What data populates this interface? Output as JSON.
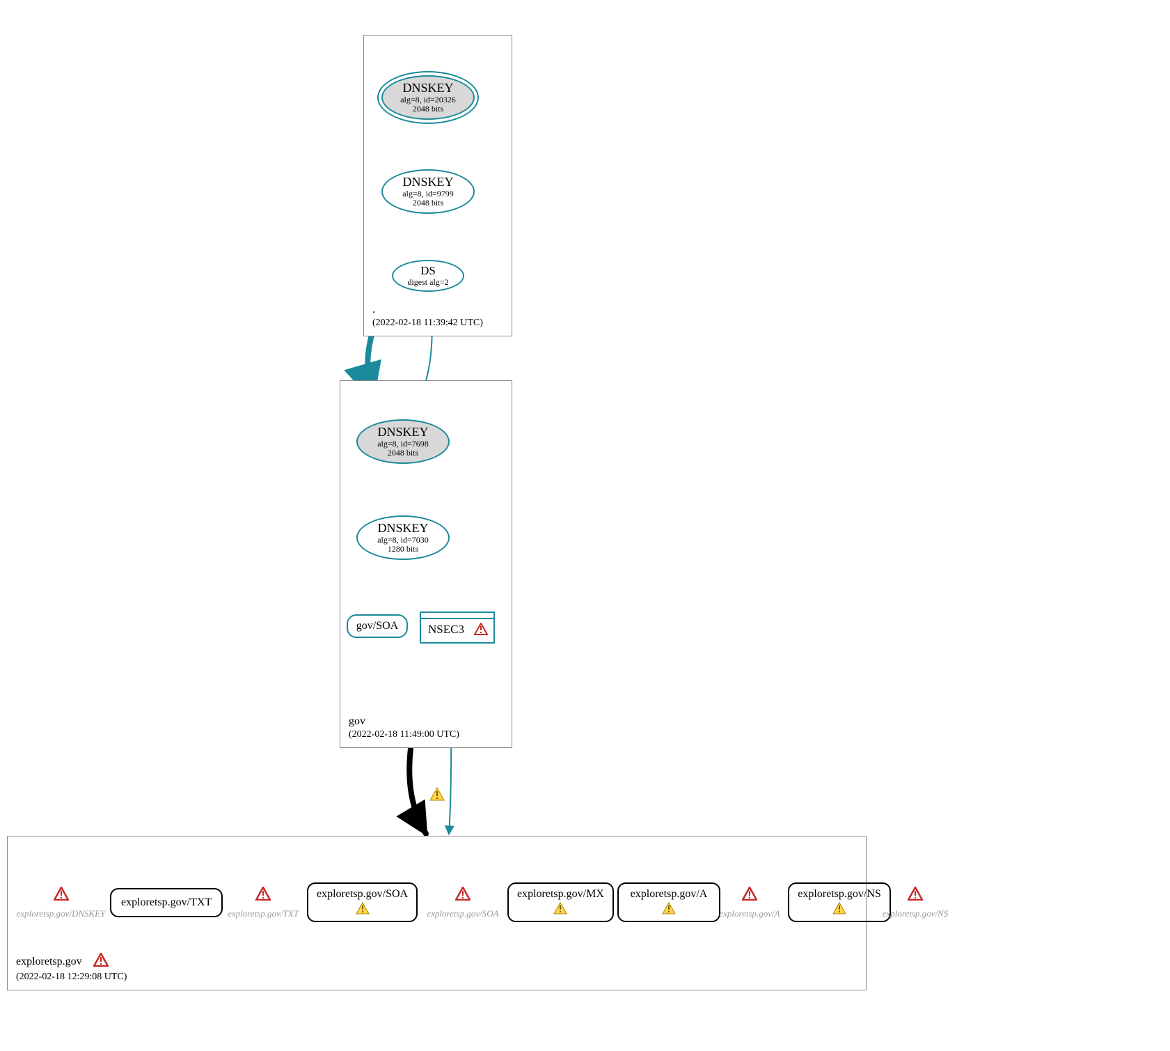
{
  "colors": {
    "teal": "#1b8a9a",
    "gray_border": "#888888"
  },
  "zones": {
    "root": {
      "name": ".",
      "timestamp": "(2022-02-18 11:39:42 UTC)",
      "nodes": {
        "ksk": {
          "title": "DNSKEY",
          "line2": "alg=8, id=20326",
          "line3": "2048 bits"
        },
        "zsk": {
          "title": "DNSKEY",
          "line2": "alg=8, id=9799",
          "line3": "2048 bits"
        },
        "ds": {
          "title": "DS",
          "line2": "digest alg=2"
        }
      }
    },
    "gov": {
      "name": "gov",
      "timestamp": "(2022-02-18 11:49:00 UTC)",
      "nodes": {
        "ksk": {
          "title": "DNSKEY",
          "line2": "alg=8, id=7698",
          "line3": "2048 bits"
        },
        "zsk": {
          "title": "DNSKEY",
          "line2": "alg=8, id=7030",
          "line3": "1280 bits"
        },
        "soa": {
          "label": "gov/SOA"
        },
        "nsec3": {
          "label": "NSEC3",
          "warning": "error"
        }
      }
    },
    "domain": {
      "name": "exploretsp.gov",
      "timestamp": "(2022-02-18 12:29:08 UTC)",
      "label_warning": "error",
      "leaves": [
        {
          "label": "exploretsp.gov/DNSKEY",
          "gray": true,
          "boxed": false,
          "icon": "error"
        },
        {
          "label": "exploretsp.gov/TXT",
          "gray": false,
          "boxed": true,
          "icon": null
        },
        {
          "label": "exploretsp.gov/TXT",
          "gray": true,
          "boxed": false,
          "icon": "error"
        },
        {
          "label": "exploretsp.gov/SOA",
          "gray": false,
          "boxed": true,
          "icon": "warn"
        },
        {
          "label": "exploretsp.gov/SOA",
          "gray": true,
          "boxed": false,
          "icon": "error"
        },
        {
          "label": "exploretsp.gov/MX",
          "gray": false,
          "boxed": true,
          "icon": "warn"
        },
        {
          "label": "exploretsp.gov/A",
          "gray": false,
          "boxed": true,
          "icon": "warn"
        },
        {
          "label": "exploretsp.gov/A",
          "gray": true,
          "boxed": false,
          "icon": "error"
        },
        {
          "label": "exploretsp.gov/NS",
          "gray": false,
          "boxed": true,
          "icon": "warn"
        },
        {
          "label": "exploretsp.gov/NS",
          "gray": true,
          "boxed": false,
          "icon": "error"
        }
      ]
    }
  },
  "edge_warning_icon": "warn"
}
